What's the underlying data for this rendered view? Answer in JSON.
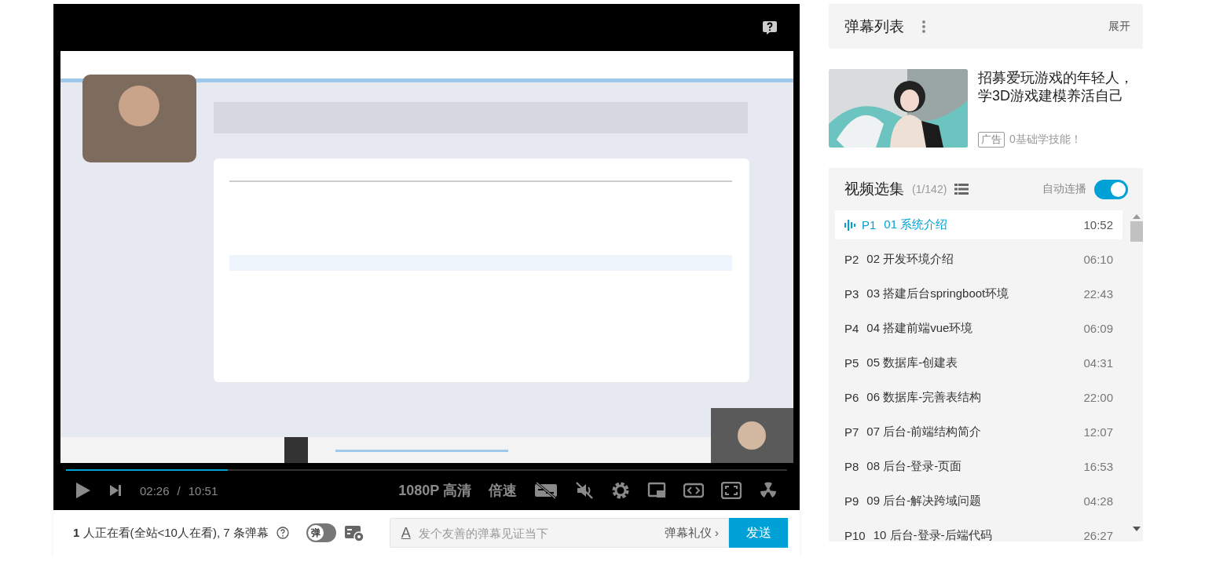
{
  "player": {
    "progress": {
      "level": 0.224
    },
    "controls": {
      "current_time": "02:26",
      "separator": "/",
      "duration": "10:51",
      "quality": "1080P 高清",
      "speed": "倍速"
    }
  },
  "info_bar": {
    "viewers": "**1** 人正在看(全站<10人在看), 7 条弹幕",
    "danmaku_switch": {
      "label": "弹",
      "on": false
    },
    "input": {
      "style_icon": "A",
      "placeholder": "发个友善的弹幕见证当下",
      "etiquette": "弹幕礼仪 ›",
      "send": "发送"
    }
  },
  "danmaku_list": {
    "title": "弹幕列表",
    "expand": "展开"
  },
  "ad": {
    "title": "招募爱玩游戏的年轻人，学3D游戏建模养活自己",
    "tag": "广告",
    "subtitle": "0基础学技能！"
  },
  "playlist": {
    "title": "视频选集",
    "count": "(1/142)",
    "autoplay": {
      "label": "自动连播",
      "on": true
    },
    "items": [
      {
        "part": "P1",
        "title": "01 系统介绍",
        "duration": "10:52",
        "selected": true
      },
      {
        "part": "P2",
        "title": "02 开发环境介绍",
        "duration": "06:10",
        "selected": false
      },
      {
        "part": "P3",
        "title": "03 搭建后台springboot环境",
        "duration": "22:43",
        "selected": false
      },
      {
        "part": "P4",
        "title": "04 搭建前端vue环境",
        "duration": "06:09",
        "selected": false
      },
      {
        "part": "P5",
        "title": "05 数据库-创建表",
        "duration": "04:31",
        "selected": false
      },
      {
        "part": "P6",
        "title": "06 数据库-完善表结构",
        "duration": "22:00",
        "selected": false
      },
      {
        "part": "P7",
        "title": "07 后台-前端结构简介",
        "duration": "12:07",
        "selected": false
      },
      {
        "part": "P8",
        "title": "08 后台-登录-页面",
        "duration": "16:53",
        "selected": false
      },
      {
        "part": "P9",
        "title": "09 后台-解决跨域问题",
        "duration": "04:28",
        "selected": false
      },
      {
        "part": "P10",
        "title": "10 后台-登录-后端代码",
        "duration": "26:27",
        "selected": false
      }
    ]
  }
}
